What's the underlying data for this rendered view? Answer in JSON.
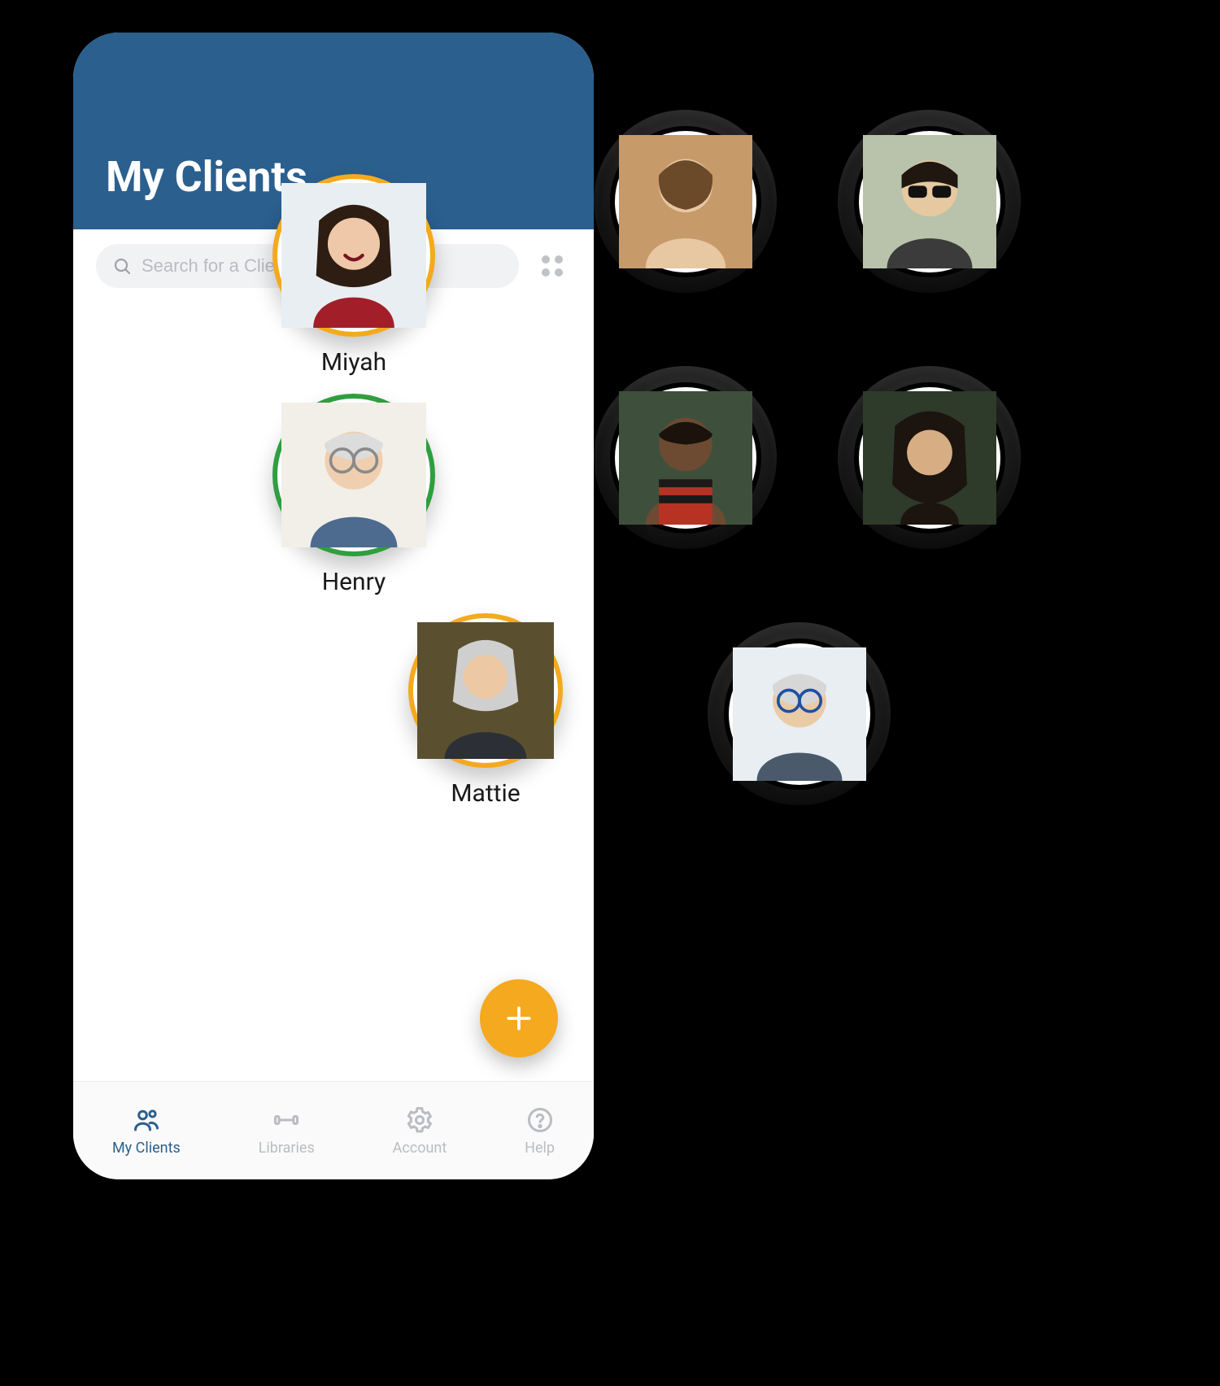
{
  "header": {
    "title": "My Clients"
  },
  "search": {
    "placeholder": "Search for a Client"
  },
  "colors": {
    "orange": "#f4a91e",
    "green": "#2f9e3f",
    "brand": "#2b5f8e"
  },
  "clients": [
    {
      "name": "Miyah",
      "ring": "orange"
    },
    {
      "name": "Henry",
      "ring": "green"
    },
    {
      "name": "Mattie",
      "ring": "orange"
    }
  ],
  "bubbles": [
    {
      "ring": "orange"
    },
    {
      "ring": "green"
    },
    {
      "ring": "green"
    },
    {
      "ring": "orange"
    },
    {
      "ring": "green"
    }
  ],
  "tabs": [
    {
      "label": "My Clients",
      "active": true
    },
    {
      "label": "Libraries",
      "active": false
    },
    {
      "label": "Account",
      "active": false
    },
    {
      "label": "Help",
      "active": false
    }
  ]
}
